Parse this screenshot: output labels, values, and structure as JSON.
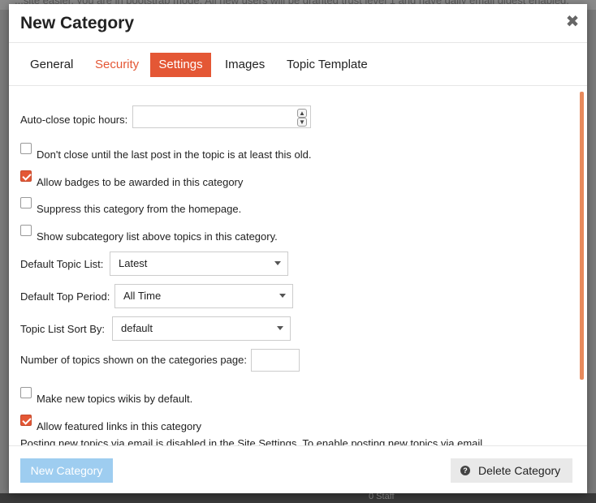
{
  "backdrop": {
    "top_text": "...site easier, you are in bootstrap mode. All new users will be granted trust level 1 and have daily email digest enabled.",
    "bottom_text": "0 Staff"
  },
  "modal": {
    "title": "New Category",
    "close_icon": "close-icon",
    "tabs": [
      {
        "label": "General",
        "active": false
      },
      {
        "label": "Security",
        "active": false
      },
      {
        "label": "Settings",
        "active": true
      },
      {
        "label": "Images",
        "active": false
      },
      {
        "label": "Topic Template",
        "active": false
      }
    ]
  },
  "settings": {
    "auto_close_label": "Auto-close topic hours:",
    "auto_close_value": "",
    "dont_close_label": "Don't close until the last post in the topic is at least this old.",
    "dont_close_checked": false,
    "badges_label": "Allow badges to be awarded in this category",
    "badges_checked": true,
    "suppress_label": "Suppress this category from the homepage.",
    "suppress_checked": false,
    "subcategory_label": "Show subcategory list above topics in this category.",
    "subcategory_checked": false,
    "default_topic_list_label": "Default Topic List:",
    "default_topic_list_value": "Latest",
    "default_top_period_label": "Default Top Period:",
    "default_top_period_value": "All Time",
    "sort_by_label": "Topic List Sort By:",
    "sort_by_value": "default",
    "num_topics_label": "Number of topics shown on the categories page:",
    "num_topics_value": "",
    "wikis_label": "Make new topics wikis by default.",
    "wikis_checked": false,
    "featured_links_label": "Allow featured links in this category",
    "featured_links_checked": true,
    "email_note": "Posting new topics via email is disabled in the Site Settings. To enable posting new topics via email,"
  },
  "footer": {
    "create_label": "New Category",
    "delete_label": "Delete Category",
    "delete_icon": "question-icon"
  },
  "colors": {
    "accent": "#e45735",
    "primary_disabled": "#9ecdf0"
  }
}
